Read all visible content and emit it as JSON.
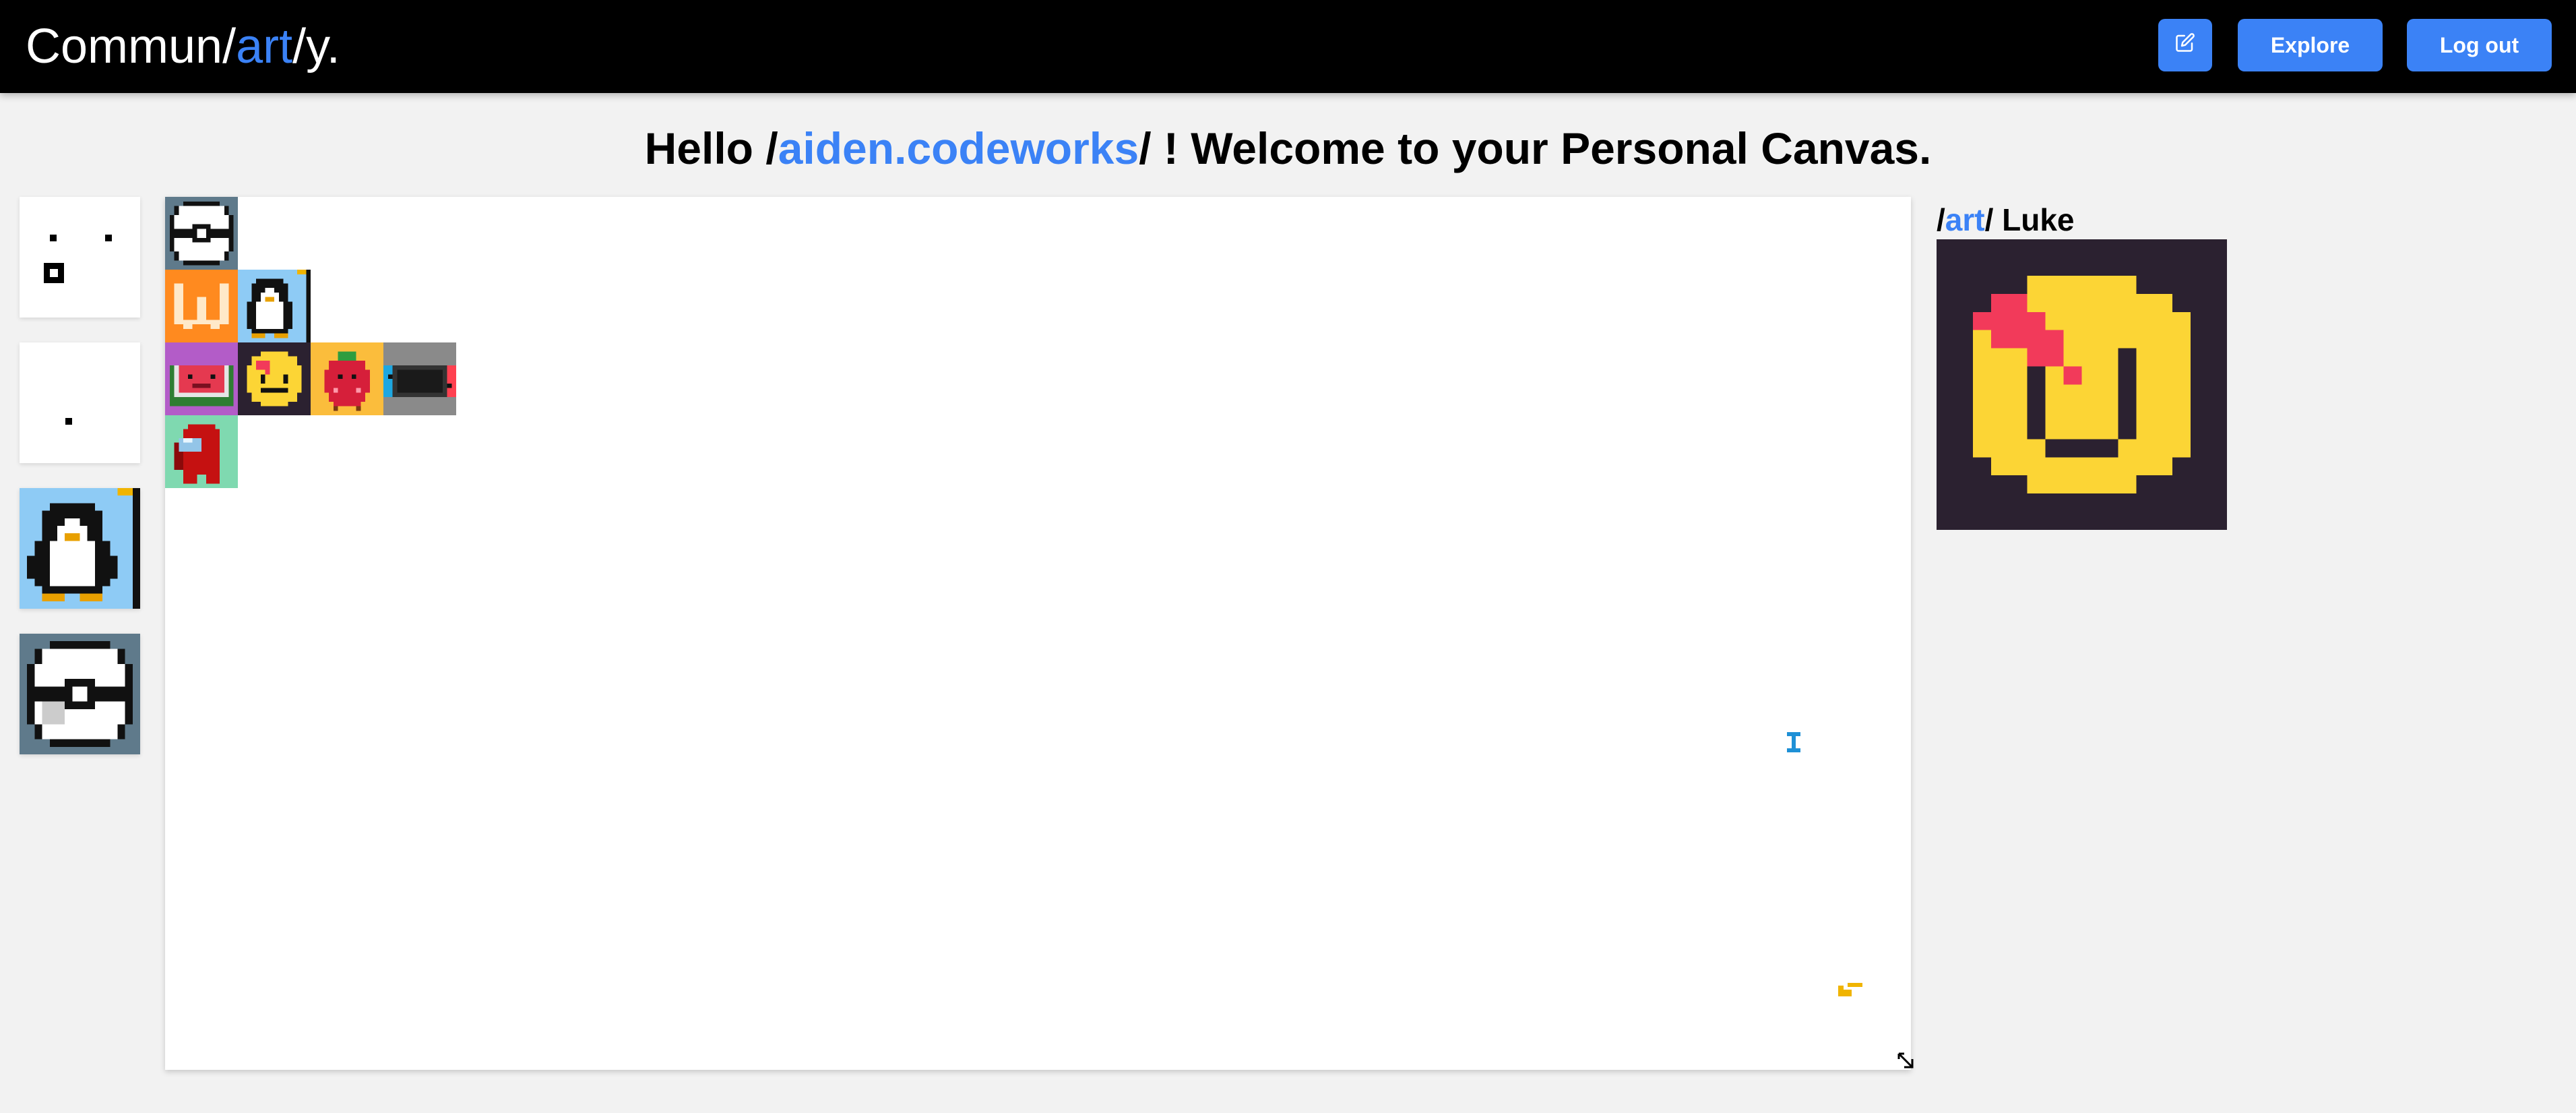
{
  "app": {
    "brand_prefix": "Commun/",
    "brand_accent": "art",
    "brand_suffix": "/y."
  },
  "nav": {
    "edit_icon": "pencil-square-icon",
    "explore_label": "Explore",
    "logout_label": "Log out"
  },
  "greeting": {
    "prefix": "Hello /",
    "username": "aiden.codeworks",
    "suffix": "/ ! Welcome to your Personal Canvas."
  },
  "sidebar": {
    "thumbnails": [
      "sparse-dots-art",
      "single-dot-art",
      "penguin-art",
      "pokeball-art"
    ]
  },
  "canvas": {
    "tiles": [
      "pokeball",
      "w-logo",
      "penguin",
      "watermelon",
      "smiley",
      "strawberry",
      "switch-console",
      "crewmate"
    ]
  },
  "preview": {
    "title_prefix": "/",
    "title_accent": "art",
    "title_suffix": "/ Luke",
    "subject": "yellow smiley with red scar"
  },
  "colors": {
    "accent": "#3b82f6",
    "navbar": "#000000",
    "background": "#f2f2f2",
    "preview_bg": "#2b2130",
    "smiley_yellow": "#fcd535",
    "scar_red": "#f23a5a"
  }
}
